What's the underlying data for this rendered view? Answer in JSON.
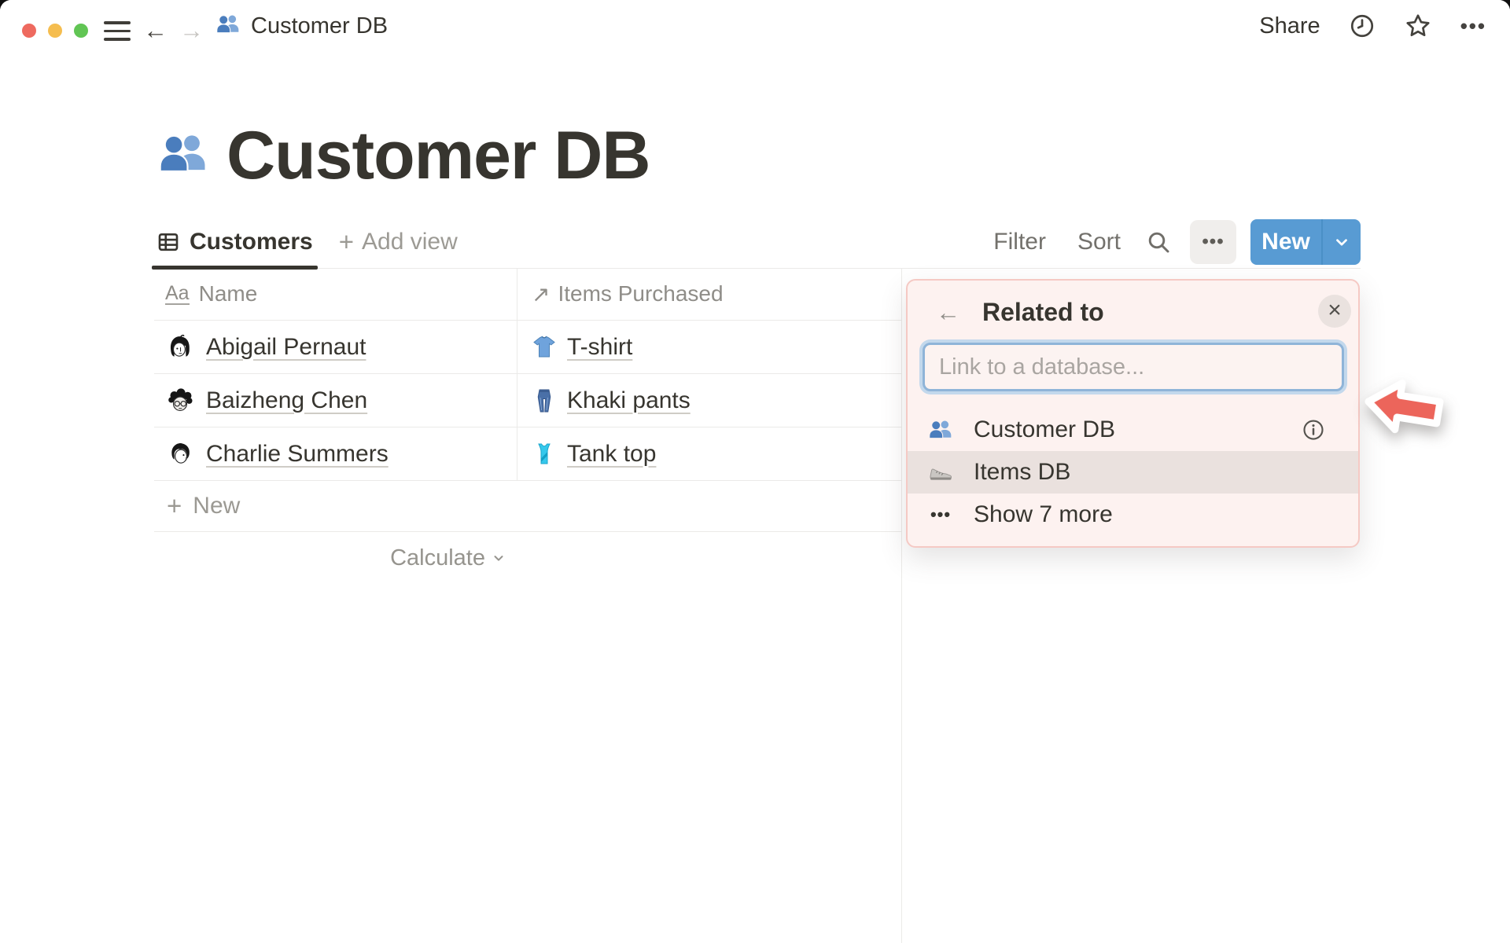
{
  "titlebar": {
    "back_glyph": "←",
    "forward_glyph": "→",
    "breadcrumb": {
      "icon": "people-icon",
      "label": "Customer DB"
    },
    "share_label": "Share",
    "more_glyph": "•••"
  },
  "page": {
    "icon": "people-icon",
    "title": "Customer DB"
  },
  "view_bar": {
    "tabs": [
      {
        "label": "Customers",
        "icon": "table-view-icon",
        "active": true
      }
    ],
    "add_view": {
      "glyph": "+",
      "label": "Add view"
    },
    "filter_label": "Filter",
    "sort_label": "Sort",
    "more_glyph": "•••",
    "new_button": {
      "label": "New",
      "color": "#589bd3"
    }
  },
  "table": {
    "columns": [
      {
        "label": "Name",
        "icon": "text-type-icon",
        "icon_glyph": "Aa"
      },
      {
        "label": "Items Purchased",
        "icon": "relation-icon",
        "icon_glyph": "↗"
      }
    ],
    "rows": [
      {
        "name": "Abigail Pernaut",
        "avatar": "abigail-avatar",
        "item": {
          "label": "T-shirt",
          "icon": "tshirt-icon"
        }
      },
      {
        "name": "Baizheng Chen",
        "avatar": "baizheng-avatar",
        "item": {
          "label": "Khaki pants",
          "icon": "jeans-icon"
        }
      },
      {
        "name": "Charlie Summers",
        "avatar": "charlie-avatar",
        "item": {
          "label": "Tank top",
          "icon": "tanktop-icon"
        }
      }
    ],
    "new_row": {
      "glyph": "+",
      "label": "New"
    },
    "footer": {
      "calculate_label": "Calculate"
    }
  },
  "popup": {
    "back_glyph": "←",
    "title": "Related to",
    "close_glyph": "×",
    "search": {
      "placeholder": "Link to a database...",
      "value": ""
    },
    "options": [
      {
        "label": "Customer DB",
        "icon": "people-icon",
        "trailing": "info-icon"
      },
      {
        "label": "Items DB",
        "icon": "sneaker-icon",
        "highlighted": true
      }
    ],
    "show_more": {
      "glyph": "•••",
      "label": "Show 7 more"
    }
  },
  "colors": {
    "accent_blue": "#589bd3",
    "annotation_red": "#ec655b",
    "popup_bg": "#fdf2f0",
    "popup_border": "#f5c9c4",
    "highlight_row": "#eae1de",
    "text_dark": "#37352f"
  }
}
